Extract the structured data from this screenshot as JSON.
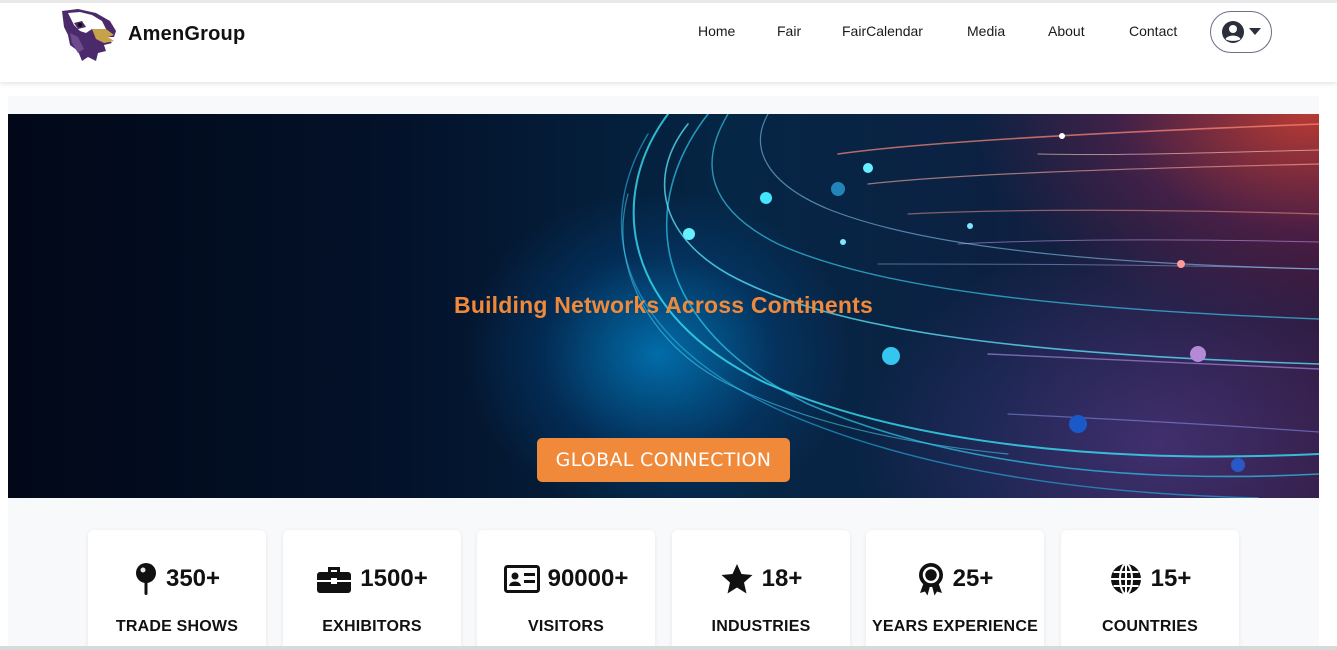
{
  "header": {
    "brand_name": "AmenGroup",
    "brand_icon": "eagle-logo"
  },
  "nav": {
    "items": [
      {
        "label": "Home"
      },
      {
        "label": "Fair"
      },
      {
        "label": "FairCalendar"
      },
      {
        "label": "Media"
      },
      {
        "label": "About"
      },
      {
        "label": "Contact"
      }
    ],
    "user_icon": "user-circle-icon",
    "dropdown_icon": "caret-down-icon"
  },
  "hero": {
    "title": "Building Networks Across Continents",
    "button_label": "GLOBAL CONNECTION"
  },
  "stats": [
    {
      "icon": "map-pin-icon",
      "value": "350+",
      "label": "TRADE SHOWS"
    },
    {
      "icon": "briefcase-icon",
      "value": "1500+",
      "label": "EXHIBITORS"
    },
    {
      "icon": "id-card-icon",
      "value": "90000+",
      "label": "VISITORS"
    },
    {
      "icon": "star-icon",
      "value": "18+",
      "label": "INDUSTRIES"
    },
    {
      "icon": "award-icon",
      "value": "25+",
      "label": "YEARS EXPERIENCE"
    },
    {
      "icon": "globe-icon",
      "value": "15+",
      "label": "COUNTRIES"
    }
  ],
  "colors": {
    "accent": "#f08a3a",
    "text": "#111111"
  }
}
